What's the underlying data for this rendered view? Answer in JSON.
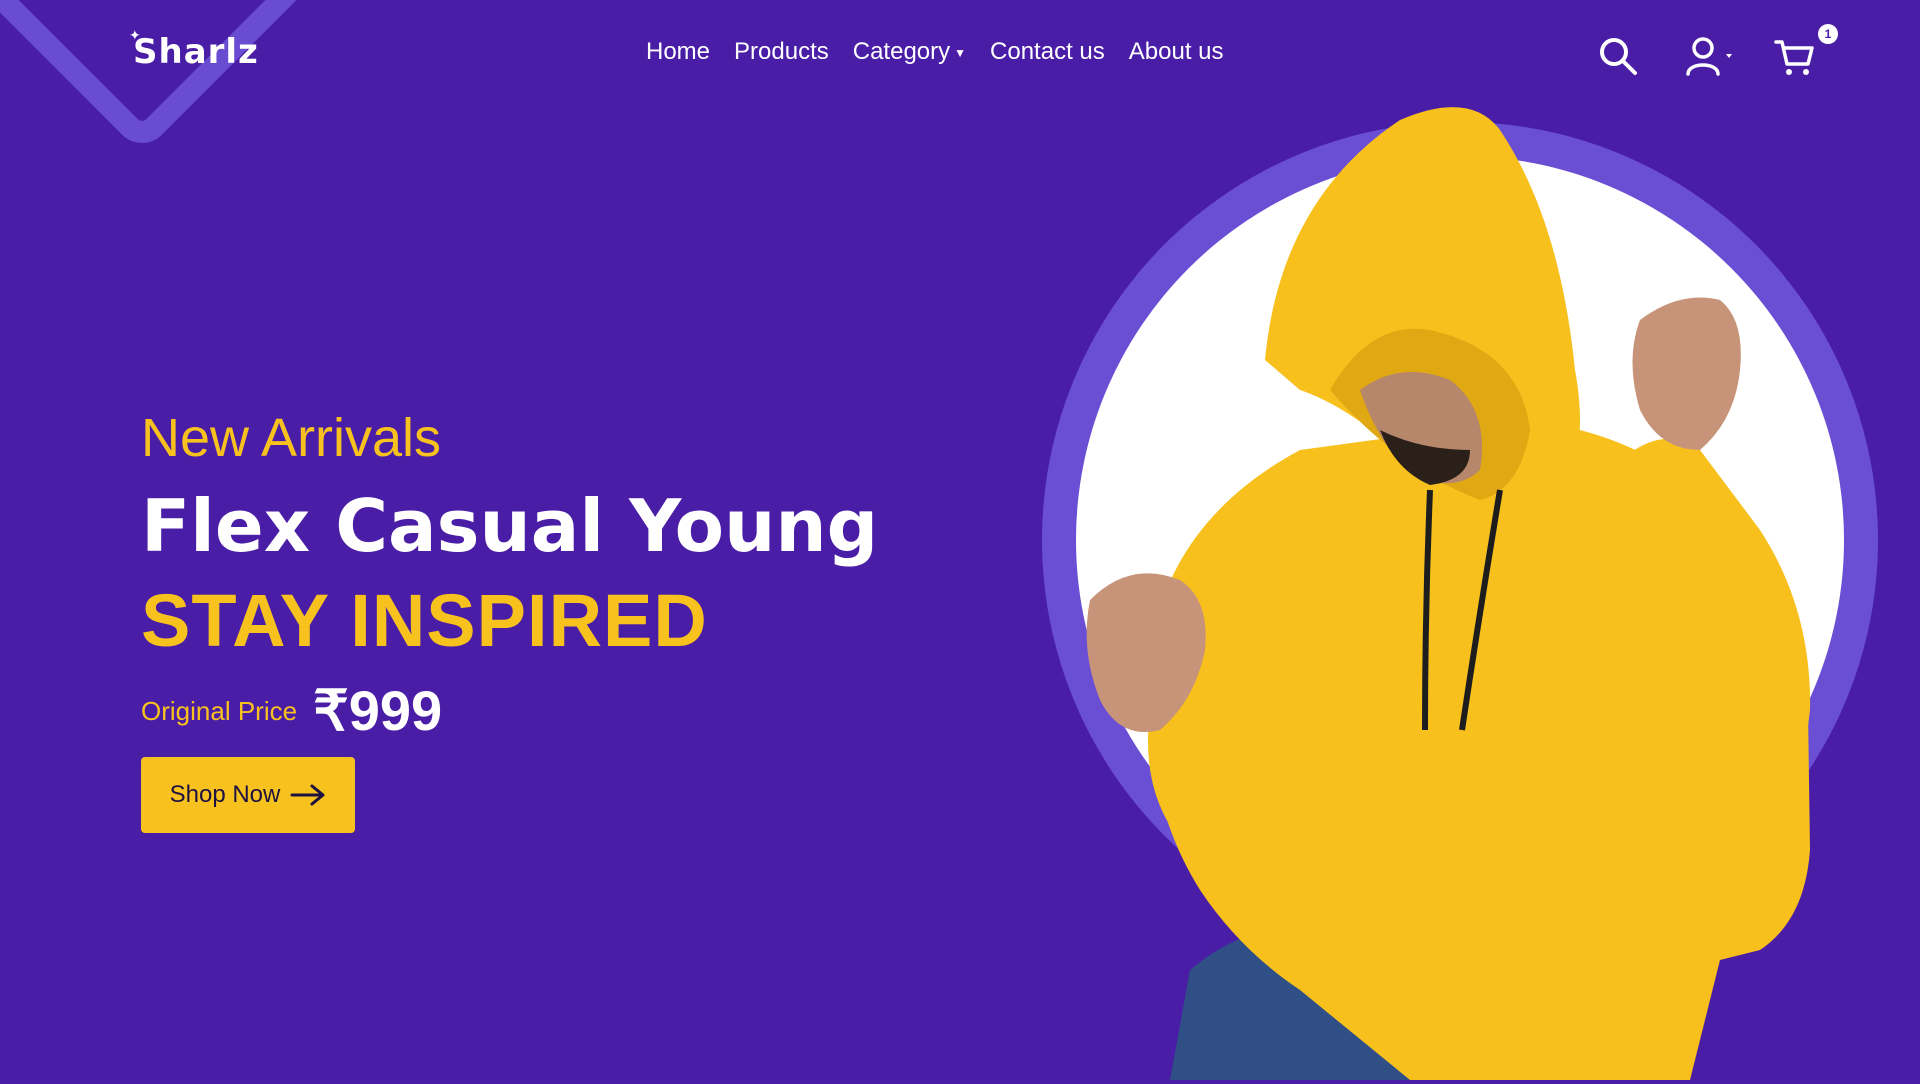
{
  "brand": {
    "name": "Sharlz"
  },
  "nav": {
    "home": "Home",
    "products": "Products",
    "category": "Category",
    "contact": "Contact us",
    "about": "About us"
  },
  "header_icons": {
    "search": "search-icon",
    "user": "user-icon",
    "cart": "cart-icon",
    "cart_count": "1"
  },
  "hero": {
    "eyebrow": "New Arrivals",
    "headline": "Flex Casual Young",
    "tagline": "STAY INSPIRED",
    "price_label": "Original Price",
    "price": "₹999",
    "cta_label": "Shop Now",
    "cta_icon": "arrow-right-icon",
    "image": "man in yellow hoodie"
  },
  "colors": {
    "background": "#4a1da6",
    "accent": "#f8c21e",
    "circle_ring": "#6a4fd4",
    "text": "#ffffff"
  }
}
